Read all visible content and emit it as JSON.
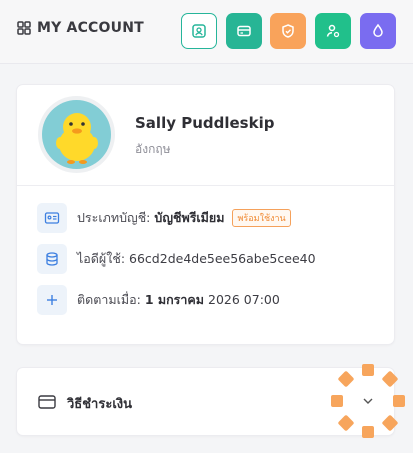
{
  "header": {
    "title": "MY ACCOUNT",
    "buttons": [
      {
        "name": "profile-button",
        "icon": "user-square-icon",
        "color": "#ffffff",
        "border": "#26b59a",
        "icon_color": "#26b59a"
      },
      {
        "name": "payment-button",
        "icon": "card-icon",
        "color": "#27b595",
        "icon_color": "#ffffff"
      },
      {
        "name": "badge-button",
        "icon": "shield-check-icon",
        "color": "#f9a35b",
        "icon_color": "#ffffff"
      },
      {
        "name": "user-settings-button",
        "icon": "user-gear-icon",
        "color": "#21c08b",
        "icon_color": "#ffffff"
      },
      {
        "name": "theme-button",
        "icon": "drop-icon",
        "color": "#7a6cf0",
        "icon_color": "#ffffff"
      }
    ]
  },
  "profile": {
    "name": "Sally Puddleskip",
    "language": "อังกฤษ",
    "avatar": "yellow-duck-icon"
  },
  "info": {
    "account_type_label": "ประเภทบัญชี:",
    "account_type_value": "บัญชีพรีเมียม",
    "account_type_badge": "พร้อมใช้งาน",
    "user_id_label": "ไอดีผู้ใช้:",
    "user_id_value": "66cd2de4de5ee56abe5cee40",
    "follow_label": "ติดตามเมื่อ:",
    "follow_date": "1 มกราคม",
    "follow_rest": "2026 07:00"
  },
  "payment": {
    "label": "วิธีชำระเงิน",
    "icon": "credit-card-icon",
    "loading_color": "#f7a55c"
  }
}
